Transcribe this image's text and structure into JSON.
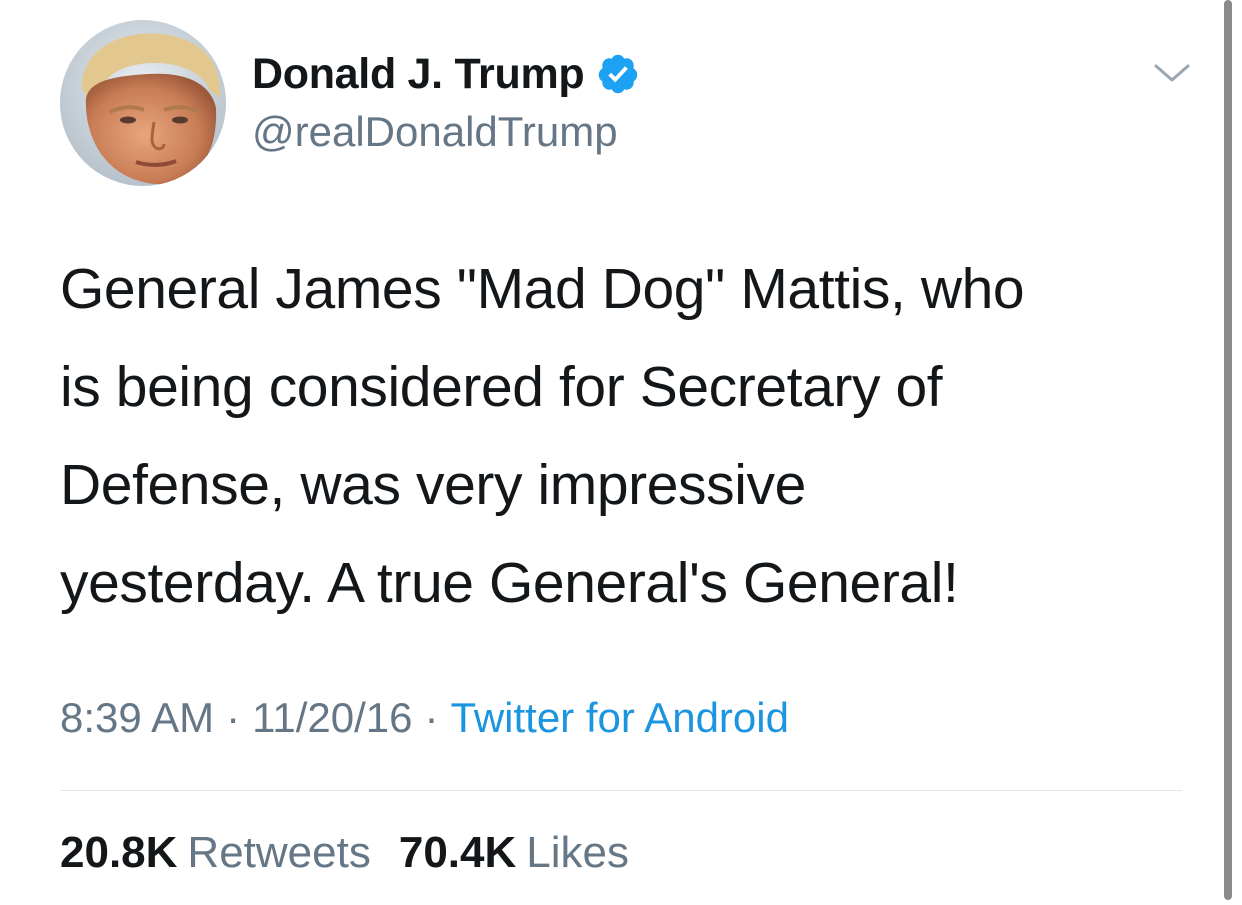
{
  "author": {
    "display_name": "Donald J. Trump",
    "handle": "@realDonaldTrump",
    "verified": true,
    "verified_icon": "verified-badge-icon",
    "avatar": "profile-photo"
  },
  "tweet": {
    "text": "General James \"Mad Dog\" Mattis, who\nis being considered for Secretary of\nDefense, was very impressive\nyesterday. A true General's General!",
    "time": "8:39 AM",
    "separator": "·",
    "date": "11/20/16",
    "source": "Twitter for Android"
  },
  "stats": {
    "retweets_count": "20.8K",
    "retweets_label": "Retweets",
    "likes_count": "70.4K",
    "likes_label": "Likes"
  },
  "icons": {
    "menu_caret": "chevron-down-icon"
  },
  "colors": {
    "text_primary": "#14171a",
    "text_secondary": "#657786",
    "link": "#1b95e0",
    "verified": "#1da1f2",
    "divider": "#e1e8ed"
  }
}
